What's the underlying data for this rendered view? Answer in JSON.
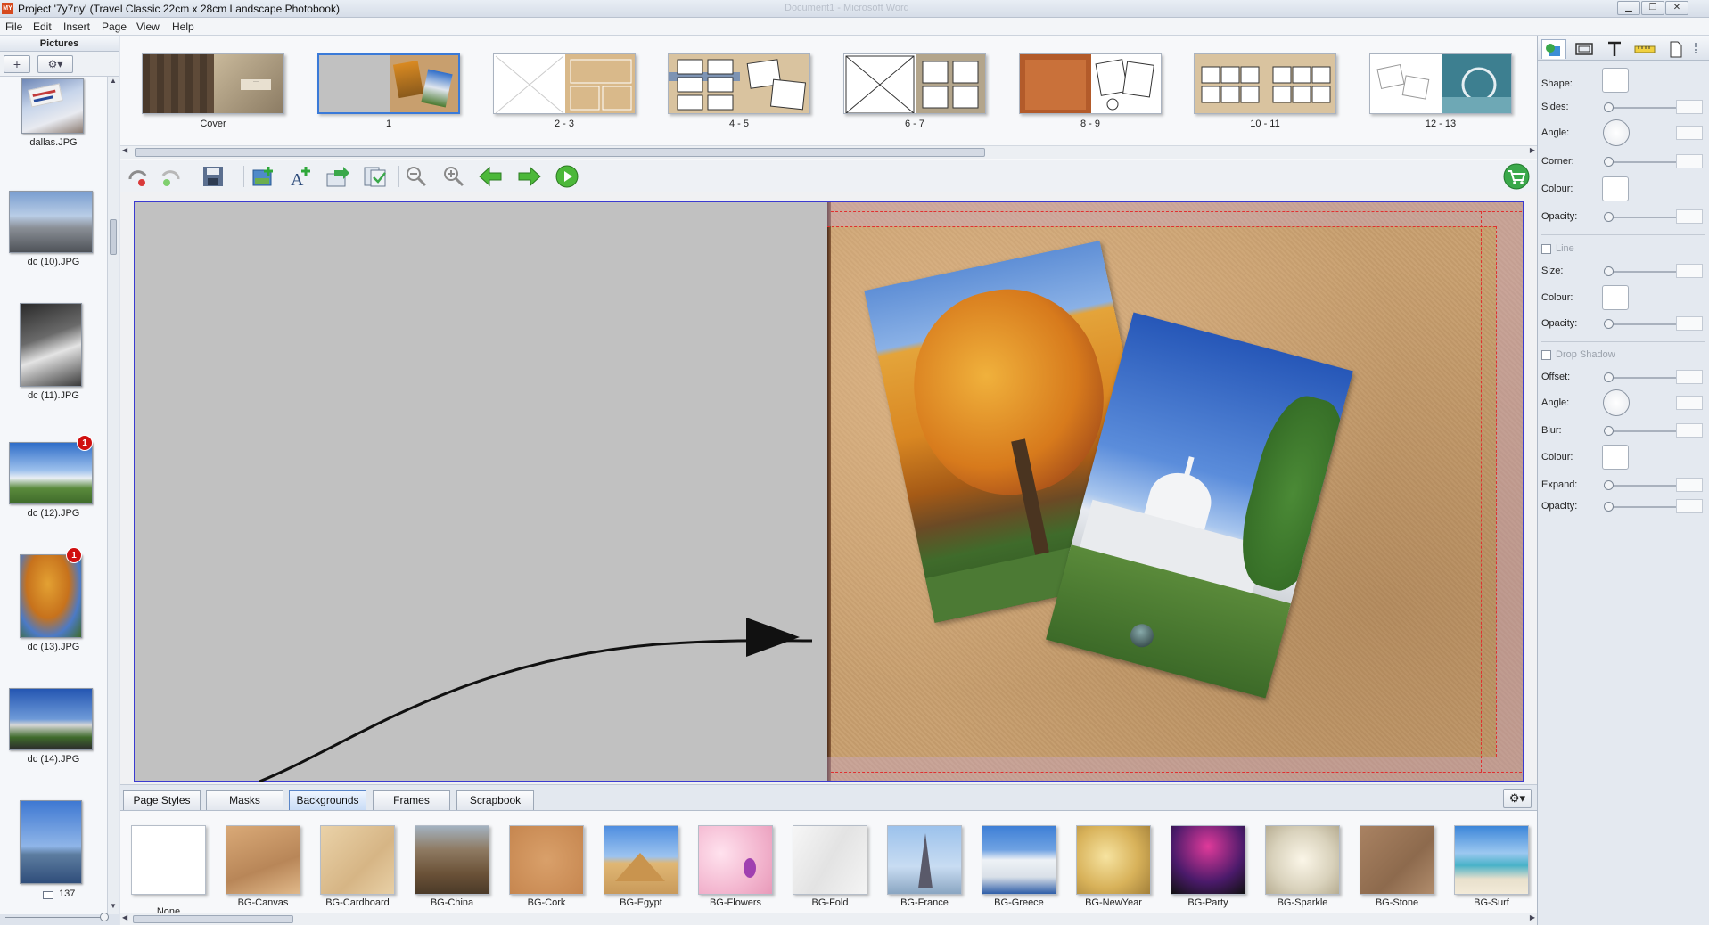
{
  "window": {
    "title": "Project '7y7ny' (Travel Classic 22cm x 28cm Landscape Photobook)",
    "background_title": "Document1 - Microsoft Word",
    "app_icon": "MY",
    "controls": [
      "minimize-icon",
      "restore-icon",
      "close-icon"
    ]
  },
  "menu": [
    "File",
    "Edit",
    "Insert",
    "Page",
    "View",
    "Help"
  ],
  "pictures": {
    "header": "Pictures",
    "add_label": "+",
    "settings_icon": "gear-icon",
    "items": [
      {
        "name": "dallas.JPG",
        "badge": ""
      },
      {
        "name": "dc (10).JPG",
        "badge": ""
      },
      {
        "name": "dc (11).JPG",
        "badge": ""
      },
      {
        "name": "dc (12).JPG",
        "badge": "1"
      },
      {
        "name": "dc (13).JPG",
        "badge": "1"
      },
      {
        "name": "dc (14).JPG",
        "badge": ""
      },
      {
        "name": "",
        "badge": ""
      }
    ],
    "count": "137"
  },
  "pages": [
    {
      "label": "Cover",
      "selected": false
    },
    {
      "label": "1",
      "selected": true
    },
    {
      "label": "2 - 3",
      "selected": false
    },
    {
      "label": "4 - 5",
      "selected": false
    },
    {
      "label": "6 - 7",
      "selected": false
    },
    {
      "label": "8 - 9",
      "selected": false
    },
    {
      "label": "10 - 11",
      "selected": false
    },
    {
      "label": "12 - 13",
      "selected": false
    }
  ],
  "toolbar": {
    "buttons": [
      "undo-icon",
      "redo-icon",
      "save-icon",
      "add-picture-icon",
      "add-text-icon",
      "import-icon",
      "export-icon",
      "zoom-out-icon",
      "zoom-in-icon",
      "previous-page-icon",
      "next-page-icon",
      "play-icon"
    ],
    "cart_icon": "shopping-cart-icon"
  },
  "canvas": {
    "left_page_color": "#c1c1c1",
    "background_color": "#c89f6e",
    "photos": [
      "autumn-tree-photo",
      "capitol-photo"
    ]
  },
  "tabs": {
    "items": [
      "Page Styles",
      "Masks",
      "Backgrounds",
      "Frames",
      "Scrapbook"
    ],
    "active": "Backgrounds"
  },
  "backgrounds": [
    "None",
    "BG-Canvas",
    "BG-Cardboard",
    "BG-China",
    "BG-Cork",
    "BG-Egypt",
    "BG-Flowers",
    "BG-Fold",
    "BG-France",
    "BG-Greece",
    "BG-NewYear",
    "BG-Party",
    "BG-Sparkle",
    "BG-Stone",
    "BG-Surf"
  ],
  "properties": {
    "tabs": [
      "shapes-icon",
      "frame-icon",
      "text-icon",
      "ruler-icon",
      "page-icon"
    ],
    "shape": {
      "shape": "Shape:",
      "sides": "Sides:",
      "angle": "Angle:",
      "corner": "Corner:",
      "colour": "Colour:",
      "opacity": "Opacity:"
    },
    "line": {
      "title": "Line",
      "size": "Size:",
      "colour": "Colour:",
      "opacity": "Opacity:"
    },
    "shadow": {
      "title": "Drop Shadow",
      "offset": "Offset:",
      "angle": "Angle:",
      "blur": "Blur:",
      "colour": "Colour:",
      "expand": "Expand:",
      "opacity": "Opacity:"
    }
  },
  "colors": {
    "accent": "#3a7ad8",
    "badge": "#d01010",
    "spread_border": "#3b3bd0",
    "bleed_line": "#e03030"
  }
}
